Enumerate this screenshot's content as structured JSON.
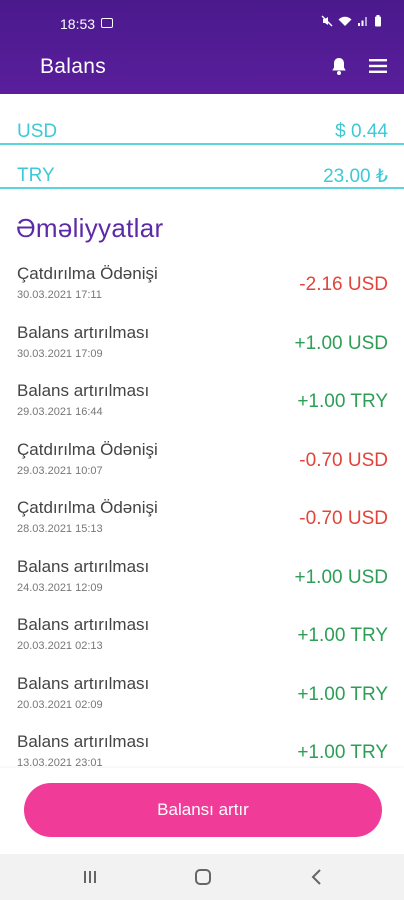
{
  "status_bar": {
    "time": "18:53"
  },
  "header": {
    "title": "Balans"
  },
  "balances": [
    {
      "currency": "USD",
      "amount": "$ 0.44"
    },
    {
      "currency": "TRY",
      "amount": "23.00 ₺"
    }
  ],
  "transactions_title": "Əməliyyatlar",
  "transactions": [
    {
      "name": "Çatdırılma Ödənişi",
      "date": "30.03.2021 17:11",
      "amount": "-2.16 USD",
      "type": "neg"
    },
    {
      "name": "Balans artırılması",
      "date": "30.03.2021 17:09",
      "amount": "+1.00 USD",
      "type": "pos"
    },
    {
      "name": "Balans artırılması",
      "date": "29.03.2021 16:44",
      "amount": "+1.00 TRY",
      "type": "pos"
    },
    {
      "name": "Çatdırılma Ödənişi",
      "date": "29.03.2021 10:07",
      "amount": "-0.70 USD",
      "type": "neg"
    },
    {
      "name": "Çatdırılma Ödənişi",
      "date": "28.03.2021 15:13",
      "amount": "-0.70 USD",
      "type": "neg"
    },
    {
      "name": "Balans artırılması",
      "date": "24.03.2021 12:09",
      "amount": "+1.00 USD",
      "type": "pos"
    },
    {
      "name": "Balans artırılması",
      "date": "20.03.2021 02:13",
      "amount": "+1.00 TRY",
      "type": "pos"
    },
    {
      "name": "Balans artırılması",
      "date": "20.03.2021 02:09",
      "amount": "+1.00 TRY",
      "type": "pos"
    },
    {
      "name": "Balans artırılması",
      "date": "13.03.2021 23:01",
      "amount": "+1.00 TRY",
      "type": "pos"
    }
  ],
  "cta_label": "Balansı artır",
  "colors": {
    "header": "#4a1a8c",
    "accent": "#3ec9d6",
    "cta": "#f03b99",
    "negative": "#e0443a",
    "positive": "#2e9e57",
    "section_title": "#5b2aa8"
  }
}
